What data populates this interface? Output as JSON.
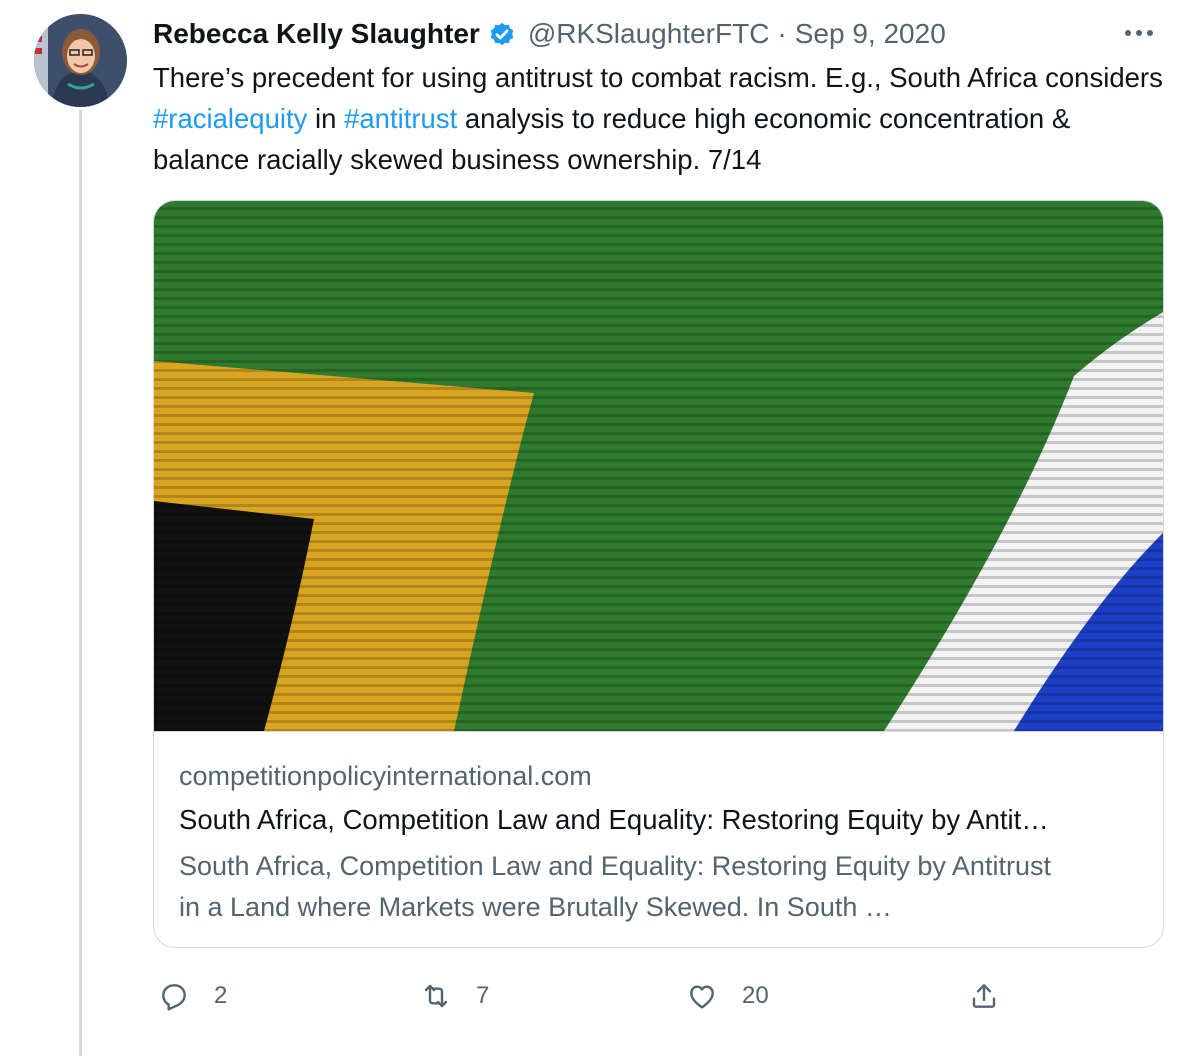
{
  "tweet": {
    "author_name": "Rebecca Kelly Slaughter",
    "handle": "@RKSlaughterFTC",
    "separator": "·",
    "date": "Sep 9, 2020",
    "text_part1": "There’s precedent for using antitrust to combat racism. E.g., South Africa considers ",
    "hashtag1": "#racialequity",
    "text_part2": " in ",
    "hashtag2": "#antitrust",
    "text_part3": " analysis to reduce high economic concentration & balance racially skewed business ownership. 7/14",
    "more_icon": "more-dots-icon",
    "verified_icon": "verified-badge-icon"
  },
  "card": {
    "domain": "competitionpolicyinternational.com",
    "title": "South Africa, Competition Law and Equality: Restoring Equity by Antit…",
    "description": "South Africa, Competition Law and Equality: Restoring Equity by Antitrust in a Land where Markets were Brutally Skewed. In South …",
    "image": "south-africa-flag-photo"
  },
  "actions": {
    "replies": "2",
    "retweets": "7",
    "likes": "20",
    "reply_icon": "reply-icon",
    "retweet_icon": "retweet-icon",
    "like_icon": "heart-icon",
    "share_icon": "share-icon"
  },
  "colors": {
    "link": "#1d9bf0",
    "text": "#0f1419",
    "secondary": "#536471",
    "border": "#cfd9de",
    "flag_green": "#2e7a2e",
    "flag_gold": "#d9a520",
    "flag_white": "#f2f2f2",
    "flag_blue": "#1b3fc8"
  }
}
